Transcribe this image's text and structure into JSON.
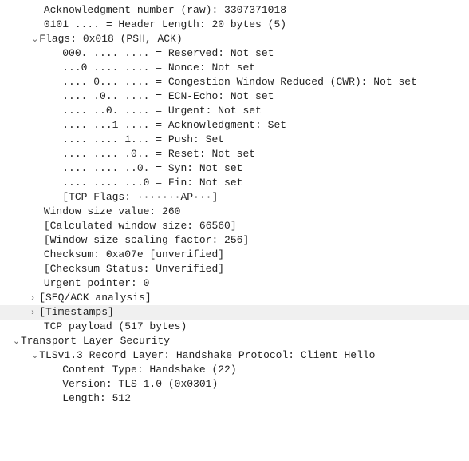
{
  "lines": {
    "ack": "Acknowledgment number (raw): 3307371018",
    "hlen": "0101 .... = Header Length: 20 bytes (5)",
    "flags": "Flags: 0x018 (PSH, ACK)",
    "reserved": "000. .... .... = Reserved: Not set",
    "nonce": "...0 .... .... = Nonce: Not set",
    "cwr": ".... 0... .... = Congestion Window Reduced (CWR): Not set",
    "ecn": ".... .0.. .... = ECN-Echo: Not set",
    "urgent": ".... ..0. .... = Urgent: Not set",
    "ackflag": ".... ...1 .... = Acknowledgment: Set",
    "push": ".... .... 1... = Push: Set",
    "reset": ".... .... .0.. = Reset: Not set",
    "syn": ".... .... ..0. = Syn: Not set",
    "fin": ".... .... ...0 = Fin: Not set",
    "tcpflags": "[TCP Flags: ·······AP···]",
    "winsize": "Window size value: 260",
    "calcwin": "[Calculated window size: 66560]",
    "winscale": "[Window size scaling factor: 256]",
    "checksum": "Checksum: 0xa07e [unverified]",
    "ckstatus": "[Checksum Status: Unverified]",
    "urgptr": "Urgent pointer: 0",
    "seqack": "[SEQ/ACK analysis]",
    "timestamps": "[Timestamps]",
    "payload": "TCP payload (517 bytes)",
    "tls": "Transport Layer Security",
    "record": "TLSv1.3 Record Layer: Handshake Protocol: Client Hello",
    "ctype": "Content Type: Handshake (22)",
    "version": "Version: TLS 1.0 (0x0301)",
    "length": "Length: 512"
  }
}
